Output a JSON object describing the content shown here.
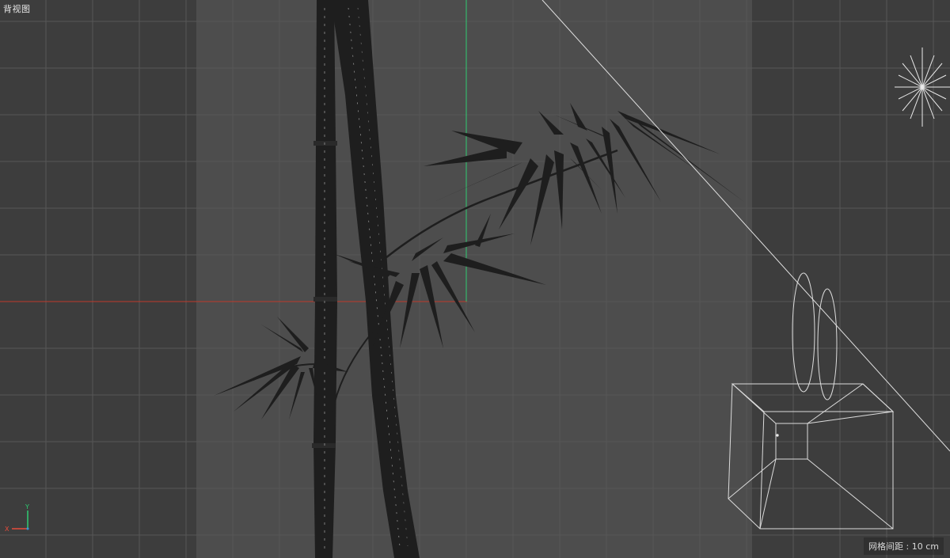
{
  "viewport": {
    "view_name": "背视图",
    "grid_spacing_label": "网格间距",
    "grid_spacing_value": "10 cm"
  },
  "axis_gizmo": {
    "y_label": "Y",
    "x_label": "X"
  },
  "colors": {
    "background": "#444444",
    "safe_frame_dark": "#3b3b3b",
    "frame_bright": "#4a4a4a",
    "grid_line": "#5a5a5a",
    "x_axis": "#c0392b",
    "y_axis": "#27ae60",
    "silhouette": "#1f1f1f",
    "wireframe": "#d8d8d8"
  },
  "scene_objects": [
    {
      "name": "bamboo-model",
      "icon": "bamboo-silhouette"
    },
    {
      "name": "light-object",
      "icon": "star-light-icon"
    },
    {
      "name": "camera-object",
      "icon": "camera-wireframe-icon"
    }
  ]
}
